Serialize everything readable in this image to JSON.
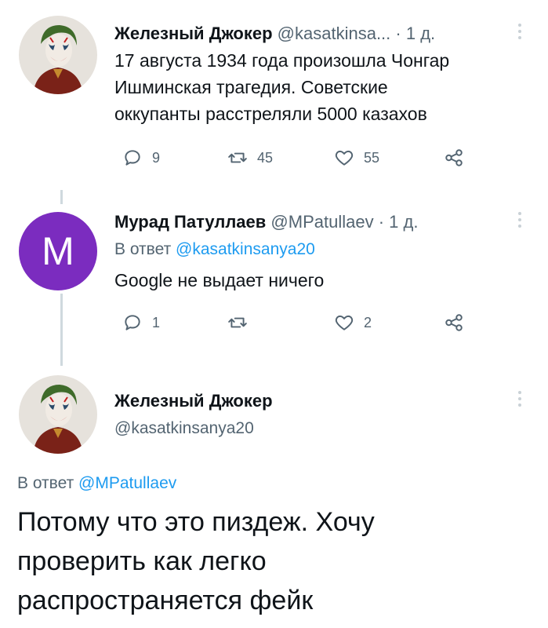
{
  "tweet1": {
    "author_name": "Железный Джокер",
    "handle": "@kasatkinsa...",
    "dot": "·",
    "time": "1 д.",
    "text_lines": [
      "17 августа  1934 года произошла Чонгар",
      "Ишминская трагедия.  Советские",
      "оккупанты  расстреляли 5000 казахов"
    ],
    "reply_count": "9",
    "retweet_count": "45",
    "like_count": "55"
  },
  "tweet2": {
    "avatar_letter": "M",
    "author_name": "Мурад Патуллаев",
    "handle": "@MPatullaev",
    "dot": "·",
    "time": "1 д.",
    "reply_prefix": "В ответ ",
    "reply_to": "@kasatkinsanya20",
    "text": "Google не выдает ничего",
    "reply_count": "1",
    "retweet_count": "",
    "like_count": "2"
  },
  "tweet3": {
    "author_name": "Железный Джокер",
    "handle": "@kasatkinsanya20",
    "reply_prefix": "В ответ ",
    "reply_to": "@MPatullaev",
    "text_lines": [
      "Потому  что это пиздеж. Хочу",
      "проверить как легко",
      "распространяется  фейк"
    ]
  },
  "icons": {
    "reply": "reply-icon",
    "retweet": "retweet-icon",
    "like": "like-icon",
    "share": "share-icon",
    "more": "more-icon"
  },
  "colors": {
    "secondary_text": "#536471",
    "link": "#1d9bf0",
    "avatar_m_bg": "#7b2cbf",
    "thread_line": "#cfd9de"
  }
}
